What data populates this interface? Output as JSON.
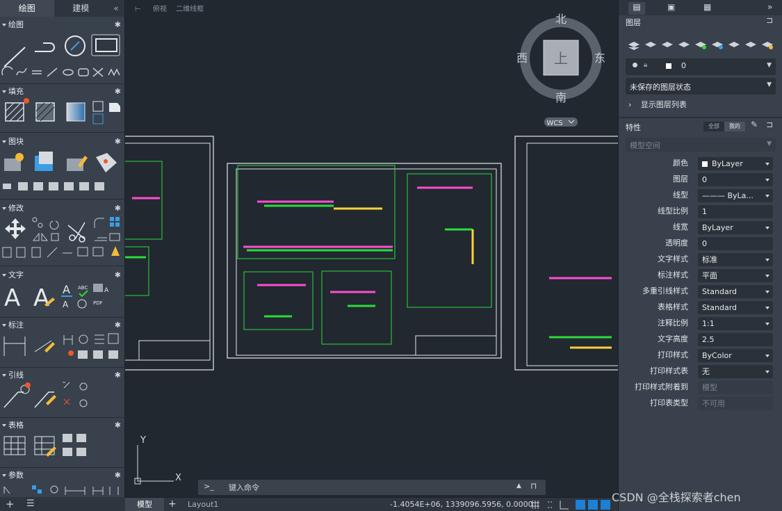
{
  "left_tabs": {
    "draw": "绘图",
    "model": "建模",
    "collapse": "«"
  },
  "sections": {
    "draw": "绘图",
    "fill": "填充",
    "block": "图块",
    "modify": "修改",
    "text": "文字",
    "dim": "标注",
    "leader": "引线",
    "table": "表格",
    "param": "参数"
  },
  "compass": {
    "n": "北",
    "s": "南",
    "e": "东",
    "w": "西",
    "top": "上",
    "wcs": "WCS"
  },
  "viewport_labels": {
    "a": "俯视",
    "b": "二维线框"
  },
  "ucs": {
    "x": "X",
    "y": "Y"
  },
  "command": {
    "prompt": ">_",
    "placeholder": "键入命令"
  },
  "status": {
    "model_tab": "模型",
    "layout_tab": "Layout1",
    "add": "+",
    "coords": "-1.4054E+06, 1339096.5956, 0.0000"
  },
  "right": {
    "layers_title": "图层",
    "layer_current": "0",
    "layer_state": "未保存的图层状态",
    "show_layer_list": "显示图层列表",
    "props_title": "特性",
    "props_all": "全部",
    "props_mine": "我的",
    "space": "模型空间",
    "props": [
      {
        "label": "颜色",
        "value": "ByLayer",
        "dd": true,
        "swatch": true
      },
      {
        "label": "图层",
        "value": "0",
        "dd": true
      },
      {
        "label": "线型",
        "value": "——— ByLa...",
        "dd": true
      },
      {
        "label": "线型比例",
        "value": "1",
        "dd": false
      },
      {
        "label": "线宽",
        "value": "ByLayer",
        "dd": true
      },
      {
        "label": "透明度",
        "value": "0",
        "dd": false
      },
      {
        "label": "文字样式",
        "value": "标准",
        "dd": true
      },
      {
        "label": "标注样式",
        "value": "平面",
        "dd": true
      },
      {
        "label": "多重引线样式",
        "value": "Standard",
        "dd": true
      },
      {
        "label": "表格样式",
        "value": "Standard",
        "dd": true
      },
      {
        "label": "注释比例",
        "value": "1:1",
        "dd": true
      },
      {
        "label": "文字高度",
        "value": "2.5",
        "dd": false
      },
      {
        "label": "打印样式",
        "value": "ByColor",
        "dd": true
      },
      {
        "label": "打印样式表",
        "value": "无",
        "dd": true
      },
      {
        "label": "打印样式附着到",
        "value": "模型",
        "dd": false,
        "dis": true
      },
      {
        "label": "打印表类型",
        "value": "不可用",
        "dd": false,
        "dis": true
      }
    ]
  },
  "watermark": "CSDN @全栈探索者chen",
  "colors": {
    "accent": "#1e7fd6",
    "bg": "#212830",
    "panel": "#38414c",
    "green": "#2bdc3a"
  }
}
